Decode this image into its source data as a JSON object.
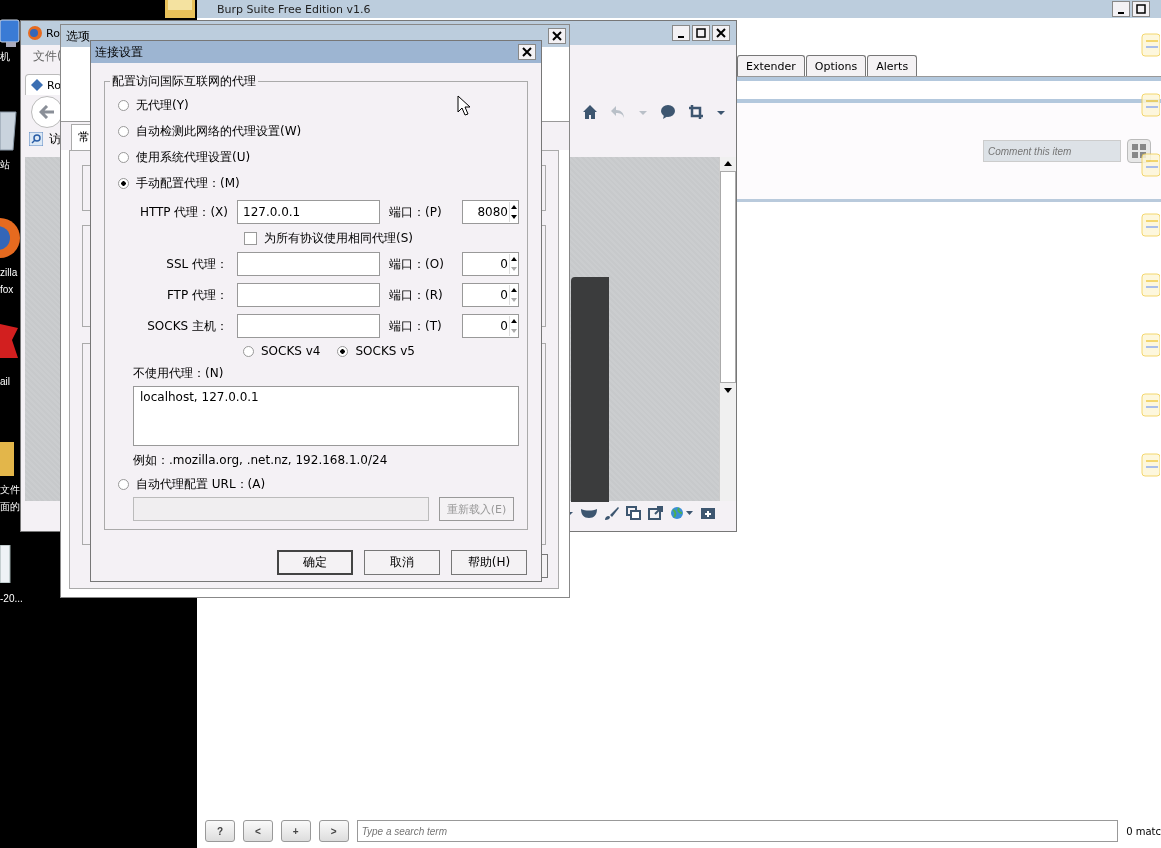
{
  "desktop_labels": [
    {
      "lines": [
        "机"
      ]
    },
    {
      "lines": [
        "站"
      ]
    },
    {
      "lines": [
        "zilla",
        "fox"
      ]
    },
    {
      "lines": [
        "ail"
      ]
    },
    {
      "lines": [
        "文件",
        "面的"
      ]
    },
    {
      "lines": [
        "-20..."
      ]
    }
  ],
  "burp": {
    "title": "Burp Suite Free Edition v1.6",
    "tabs": [
      {
        "label": "Extender",
        "selected": false
      },
      {
        "label": "Options",
        "selected": false
      },
      {
        "label": "Alerts",
        "selected": false
      }
    ],
    "comment_placeholder": "Comment this item",
    "nav_buttons": [
      "?",
      "<",
      "+",
      ">"
    ],
    "search_placeholder": "Type a search term",
    "match_count": "0 matc"
  },
  "firefox": {
    "title": "Ro",
    "menu": "文件(",
    "tab": "Ro",
    "bookmark": "访"
  },
  "options": {
    "title": "选项",
    "tab": "常"
  },
  "dialog": {
    "title": "连接设置",
    "group": "配置访问国际互联网的代理",
    "modes": [
      {
        "label": "无代理(Y)",
        "selected": false
      },
      {
        "label": "自动检测此网络的代理设置(W)",
        "selected": false
      },
      {
        "label": "使用系统代理设置(U)",
        "selected": false
      },
      {
        "label": "手动配置代理：(M)",
        "selected": true
      },
      {
        "label": "自动代理配置 URL：(A)",
        "selected": false
      }
    ],
    "proxies": [
      {
        "label": "HTTP 代理：(X)",
        "value": "127.0.0.1",
        "port_label": "端口：(P)",
        "port": "8080"
      },
      {
        "label": "SSL 代理：",
        "port_label": "端口：(O)",
        "port": "0"
      },
      {
        "label": "FTP 代理：",
        "port_label": "端口：(R)",
        "port": "0"
      },
      {
        "label": "SOCKS 主机：",
        "port_label": "端口：(T)",
        "port": "0"
      }
    ],
    "share": {
      "label": "为所有协议使用相同代理(S)",
      "checked": false
    },
    "socks_versions": [
      {
        "label": "SOCKS v4",
        "selected": false
      },
      {
        "label": "SOCKS v5",
        "selected": true
      }
    ],
    "no_proxy": {
      "label": "不使用代理：(N)",
      "value": "localhost, 127.0.0.1"
    },
    "example": "例如：.mozilla.org, .net.nz, 192.168.1.0/24",
    "reload": {
      "label": "重新载入(E)",
      "disabled": true
    },
    "buttons": [
      "确定",
      "取消",
      "帮助(H)"
    ]
  }
}
